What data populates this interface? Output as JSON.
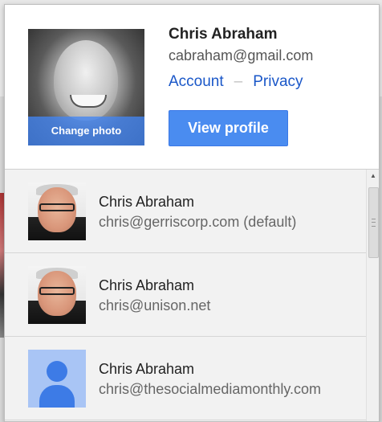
{
  "profile": {
    "name": "Chris Abraham",
    "email": "cabraham@gmail.com",
    "change_photo_label": "Change photo",
    "links": {
      "account": "Account",
      "separator": "–",
      "privacy": "Privacy"
    },
    "view_profile_label": "View profile"
  },
  "accounts": [
    {
      "name": "Chris Abraham",
      "email": "chris@gerriscorp.com (default)",
      "avatar": "photo"
    },
    {
      "name": "Chris Abraham",
      "email": "chris@unison.net",
      "avatar": "photo"
    },
    {
      "name": "Chris Abraham",
      "email": "chris@thesocialmediamonthly.com",
      "avatar": "default-person-icon"
    }
  ],
  "colors": {
    "link_blue": "#1a57c8",
    "button_blue": "#4a8cf0",
    "default_avatar_bg": "#a9c5f5",
    "default_avatar_fg": "#3d7be6"
  }
}
